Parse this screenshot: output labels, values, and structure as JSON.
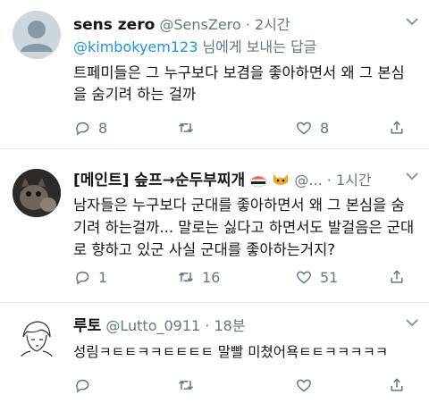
{
  "tweets": [
    {
      "name": "sens zero",
      "handle": "@SensZero",
      "time": "2시간",
      "reply_mention": "@kimbokyem123",
      "reply_suffix": " 님에게 보내는 답글",
      "lines": [
        "트페미들은 그 누구보다 보겸을 좋아하면서 왜 그 본심",
        "을 숨기려 하는 걸까"
      ],
      "stats": {
        "replies": "8",
        "retweets": "",
        "likes": "8"
      }
    },
    {
      "name": "[메인트] 슾프→순두부찌개",
      "handle": "@...",
      "time": "1시간",
      "lines": [
        "남자들은 누구보다 군대를 좋아하면서 왜 그 본심을 숨",
        "기려 하는걸까... 말로는 싫다고 하면서도 발걸음은 군대",
        "로 향하고 있군 사실 군대를 좋아하는거지?"
      ],
      "stats": {
        "replies": "1",
        "retweets": "16",
        "likes": "51"
      }
    },
    {
      "name": "루토",
      "handle": "@Lutto_0911",
      "time": "18분",
      "lines": [
        "성림ㅋㅌㅌㅋㅋㅌㅌㅌㅌ 말빨 미쳤어욕ㅌㅌㅋㅋㅋㅋㅋ"
      ],
      "stats": {
        "replies": "",
        "retweets": "",
        "likes": ""
      }
    }
  ],
  "separator": "·",
  "icons": [
    "more-chevron-icon",
    "reply-icon",
    "retweet-icon",
    "like-icon",
    "share-icon",
    "sushi-emoji-icon",
    "cat-emoji-icon"
  ],
  "colors": {
    "link": "#1b95e0",
    "muted": "#657786",
    "divider": "#e6ecf0"
  }
}
